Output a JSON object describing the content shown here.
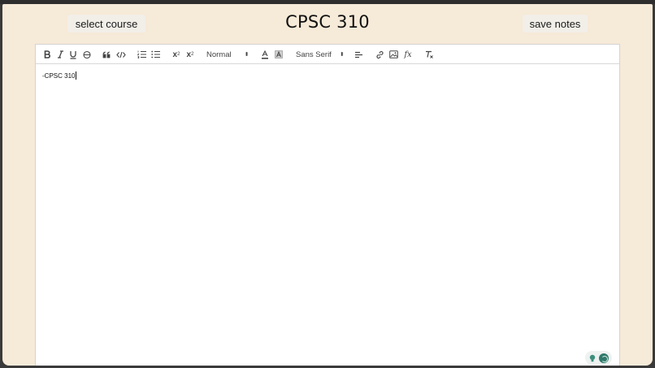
{
  "header": {
    "title": "CPSC 310",
    "select_course_label": "select course",
    "save_notes_label": "save notes"
  },
  "toolbar": {
    "header_picker": "Normal",
    "font_picker": "Sans Serif",
    "subscript_label": "x",
    "subscript_mark": "2",
    "superscript_label": "x",
    "superscript_mark": "2",
    "formula_label": "fx"
  },
  "editor": {
    "content": "-CPSC 310"
  },
  "colors": {
    "background": "#f6ead8",
    "button": "#f2efe8",
    "widget_accent": "#2f7a6b"
  },
  "icons": [
    "bold-icon",
    "italic-icon",
    "underline-icon",
    "strike-icon",
    "blockquote-icon",
    "code-block-icon",
    "ordered-list-icon",
    "bullet-list-icon",
    "subscript-icon",
    "superscript-icon",
    "text-color-icon",
    "background-color-icon",
    "align-icon",
    "link-icon",
    "image-icon",
    "formula-icon",
    "clean-formatting-icon",
    "lightbulb-icon",
    "avatar-icon"
  ]
}
